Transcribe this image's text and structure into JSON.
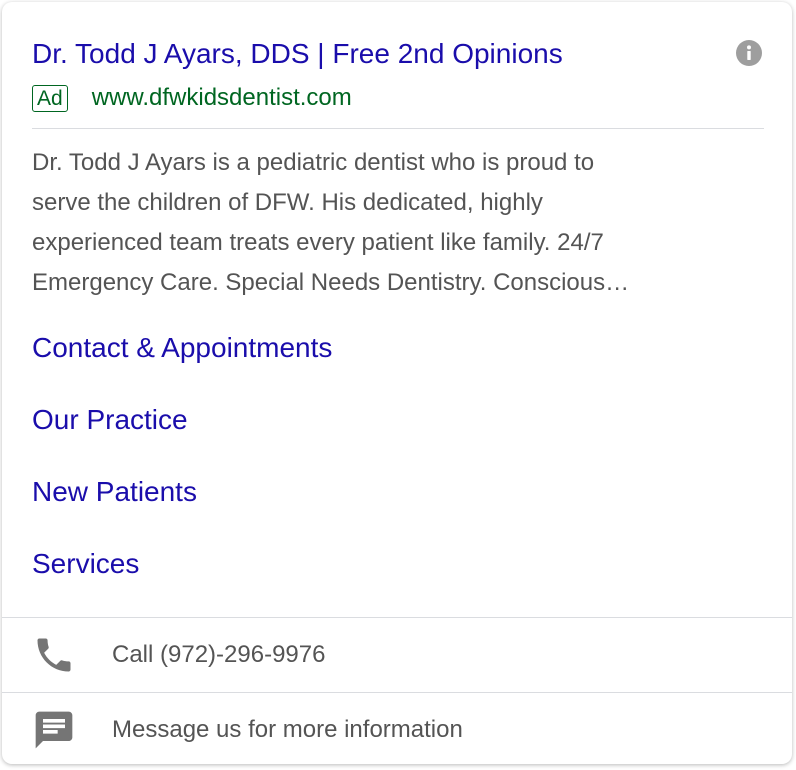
{
  "ad": {
    "title": "Dr. Todd J Ayars, DDS | Free 2nd Opinions",
    "badge": "Ad",
    "display_url": "www.dfwkidsdentist.com",
    "description_lines": [
      "Dr. Todd J Ayars is a pediatric dentist who is proud to",
      "serve the children of DFW. His dedicated, highly",
      "experienced team treats every patient like family. 24/7",
      "Emergency Care. Special Needs Dentistry. Conscious…"
    ],
    "info_icon": "info-icon"
  },
  "sitelinks": [
    {
      "label": "Contact & Appointments"
    },
    {
      "label": "Our Practice"
    },
    {
      "label": "New Patients"
    },
    {
      "label": "Services"
    }
  ],
  "actions": {
    "call": {
      "icon": "phone-icon",
      "label": "Call (972)-296-9976"
    },
    "message": {
      "icon": "message-icon",
      "label": "Message us for more information"
    }
  },
  "colors": {
    "link_blue": "#1a0dab",
    "url_green": "#006621",
    "body_text": "#545454",
    "icon_gray": "#757575",
    "divider": "#dadce0"
  }
}
